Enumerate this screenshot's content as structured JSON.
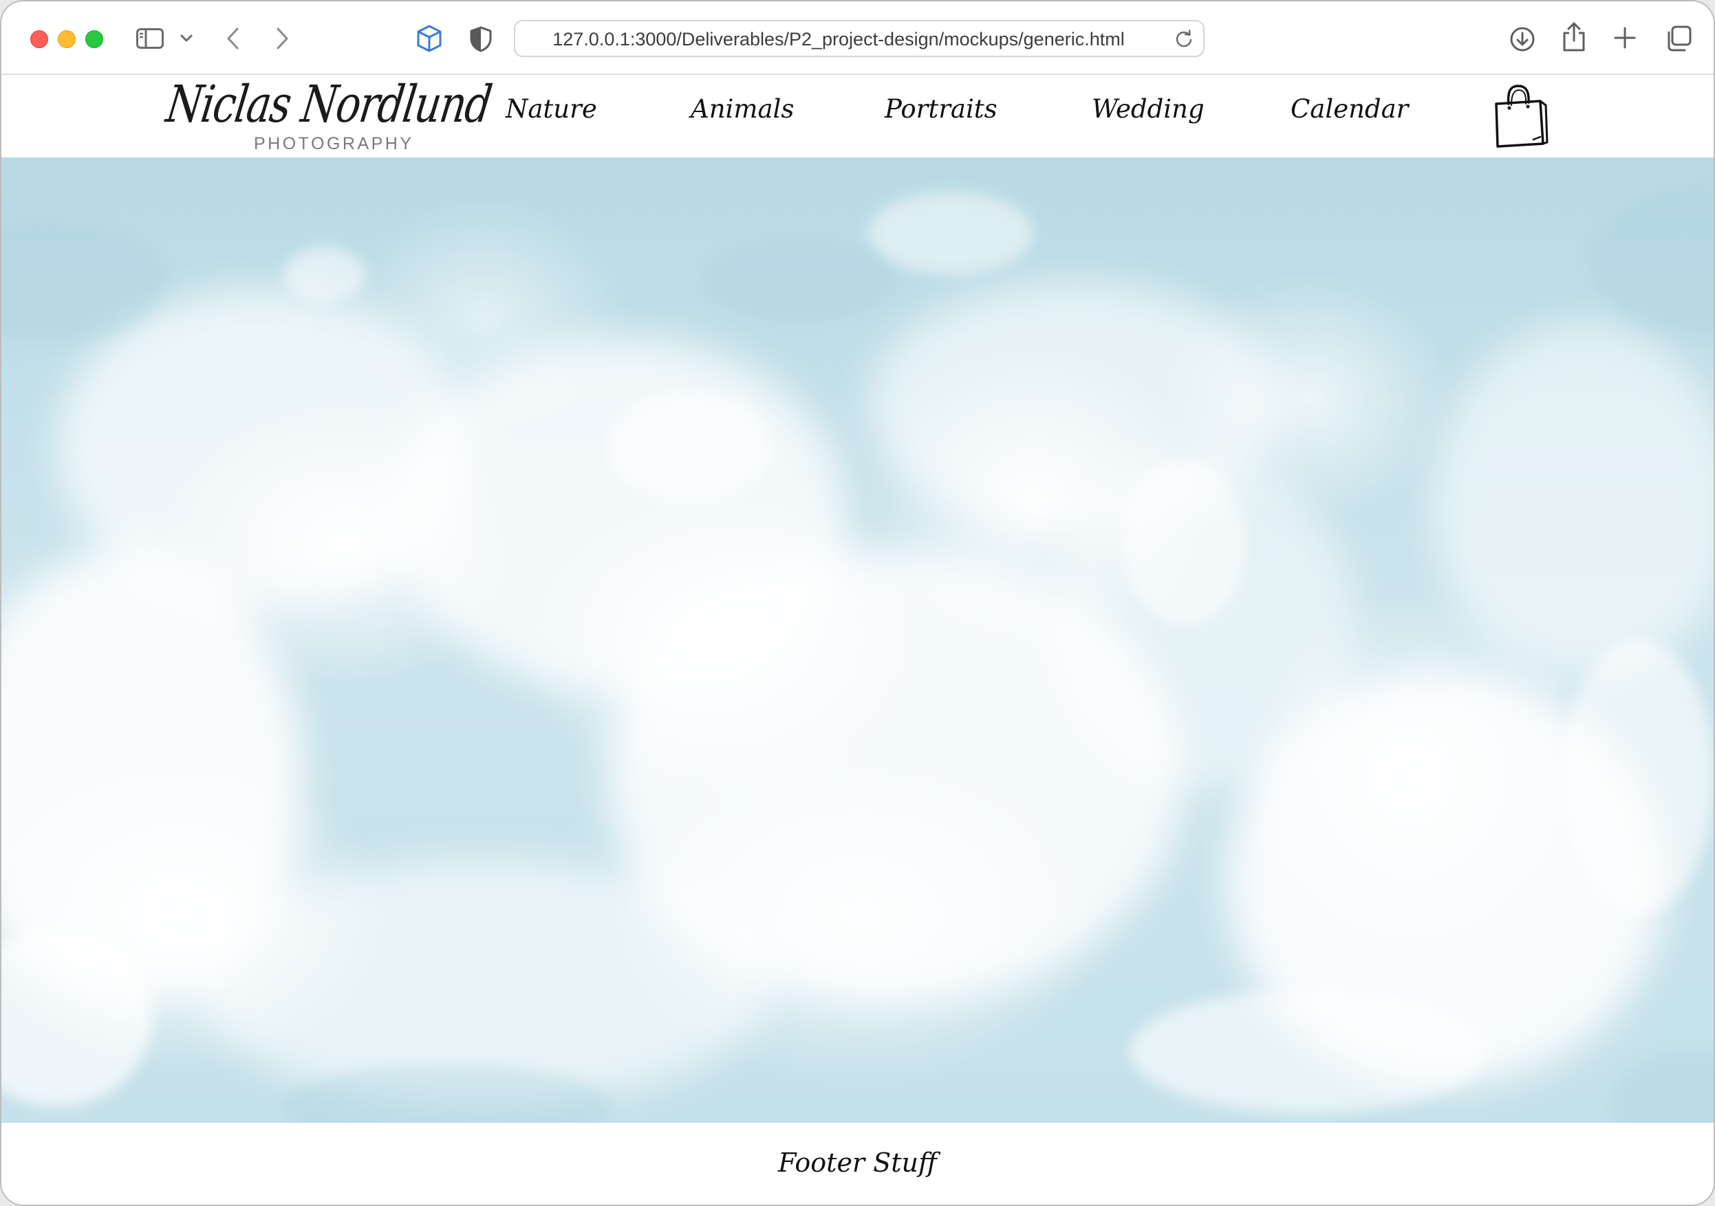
{
  "browser": {
    "url": "127.0.0.1:3000/Deliverables/P2_project-design/mockups/generic.html",
    "icons": [
      "sidebar-icon",
      "chevron-down-icon",
      "back-icon",
      "forward-icon",
      "cube-icon",
      "shield-icon",
      "reload-icon",
      "download-icon",
      "share-icon",
      "plus-icon",
      "tabs-overview-icon"
    ]
  },
  "header": {
    "logo_script": "Niclas Nordlund",
    "logo_sub": "PHOTOGRAPHY",
    "nav": [
      {
        "label": "Nature"
      },
      {
        "label": "Animals"
      },
      {
        "label": "Portraits"
      },
      {
        "label": "Wedding"
      },
      {
        "label": "Calendar"
      }
    ],
    "cart_icon": "shopping-bag-icon"
  },
  "hero": {
    "colors": {
      "base": "#b8dae4",
      "cloud": "#ffffff"
    }
  },
  "footer": {
    "text": "Footer Stuff"
  }
}
